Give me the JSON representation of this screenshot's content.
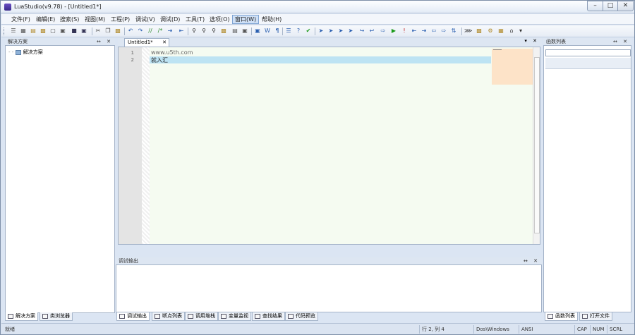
{
  "window": {
    "title": "LuaStudio(v9.78) - [Untitled1*]",
    "min": "–",
    "max": "□",
    "close": "✕"
  },
  "menu": [
    "文件(F)",
    "编辑(E)",
    "搜索(S)",
    "视图(M)",
    "工程(P)",
    "调试(V)",
    "调试(D)",
    "工具(T)",
    "选项(O)",
    "窗口(W)",
    "帮助(H)"
  ],
  "active_menu": "窗口(W)",
  "left_panel": {
    "title": "解决方案",
    "buttons": "↔ ✕",
    "root": "解决方案"
  },
  "editor": {
    "tab_label": "Untitled1*",
    "tab_close": "✕",
    "tab_buttons": "▾ ✕",
    "lines": [
      {
        "num": "1",
        "text": "www.u5th.com"
      },
      {
        "num": "2",
        "text": "就入汇"
      }
    ]
  },
  "output_panel": {
    "title": "调试输出",
    "buttons": "↔ ✕"
  },
  "right_panel": {
    "title": "函数列表",
    "buttons": "↔ ✕"
  },
  "left_tabs": [
    "解决方案",
    "类浏览器"
  ],
  "output_tabs": [
    "调试输出",
    "断点列表",
    "调用堆栈",
    "变量监视",
    "查找结果",
    "代码预览"
  ],
  "right_tabs": [
    "函数列表",
    "打开文件"
  ],
  "status": {
    "left": "就绪",
    "position": "行 2, 列 4",
    "line_end": "Dos\\Windows",
    "encoding": "ANSI",
    "cap": "CAP",
    "num": "NUM",
    "scrl": "SCRL"
  },
  "colors": {
    "editor_bg": "#f5fbf1",
    "highlight": "#bde3f3",
    "minimap": "#fde3c8"
  }
}
